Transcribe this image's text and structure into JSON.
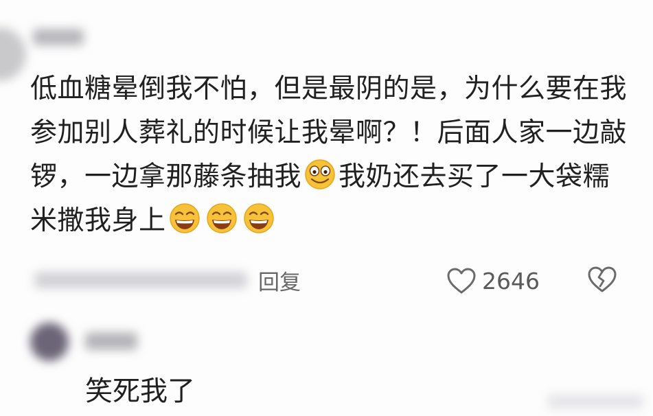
{
  "comment": {
    "segments": [
      "低血糖晕倒我不怕，但是最阴的是，为什么要在我参加别人葬礼的时候让我晕啊？！后面人家一边敲锣，一边拿那藤条抽我",
      "我奶还去买了一大袋糯米撒我身上"
    ],
    "emoji_1": "smile-emoji",
    "emoji_trailing": [
      "grin-emoji",
      "grin-emoji",
      "grin-emoji"
    ]
  },
  "actions": {
    "reply_label": "回复",
    "like_count": "2646",
    "like_icon": "heart-outline-icon",
    "dislike_icon": "broken-heart-icon"
  },
  "reply": {
    "text": "笑死我了"
  },
  "colors": {
    "text": "#202020",
    "meta": "#676767",
    "emoji_face": "#f7c23a"
  }
}
